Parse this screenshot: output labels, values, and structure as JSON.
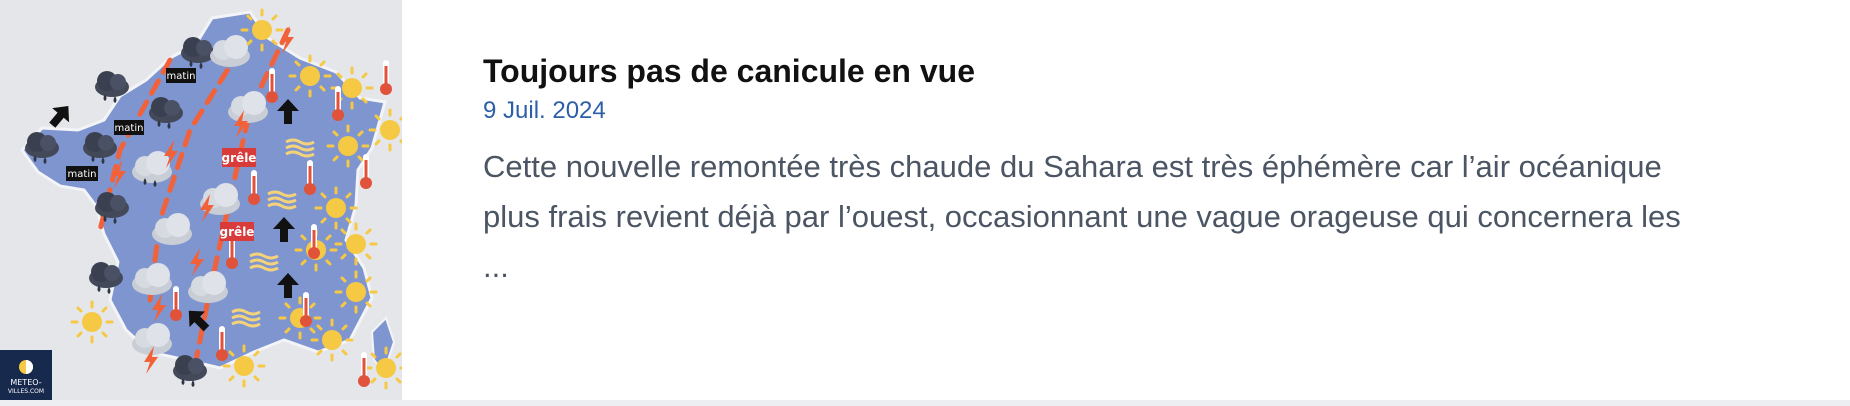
{
  "article": {
    "title": "Toujours pas de canicule en vue",
    "date": "9 Juil. 2024",
    "excerpt_line1": "Cette nouvelle remontée très chaude du Sahara est très éphémère car l’air océanique",
    "excerpt_line2": "plus frais revient déjà par l’ouest, occasionnant une vague orageuse qui concernera les",
    "excerpt_line3": "..."
  },
  "map": {
    "labels": {
      "matin_1": "matin",
      "matin_2": "matin",
      "matin_3": "matin",
      "grele_1": "grêle",
      "grele_2": "grêle"
    },
    "logo_line1": "METEO-",
    "logo_line2": "VILLES.COM"
  },
  "colors": {
    "map_land": "#7f95cf",
    "background": "#e4e6ea",
    "front": "#f2623a",
    "date": "#2c5fa7",
    "logo_bg": "#17294d"
  }
}
